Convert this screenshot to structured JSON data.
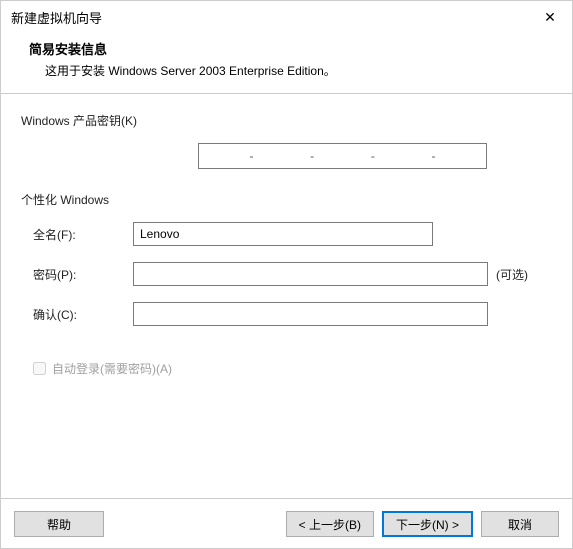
{
  "window": {
    "title": "新建虚拟机向导"
  },
  "header": {
    "subtitle": "简易安装信息",
    "description": "这用于安装 Windows Server 2003 Enterprise Edition。"
  },
  "productkey": {
    "label": "Windows 产品密钥(K)",
    "separator": "-"
  },
  "personalize": {
    "label": "个性化 Windows",
    "fullname_label": "全名(F):",
    "fullname_value": "Lenovo",
    "password_label": "密码(P):",
    "password_value": "",
    "password_hint": "(可选)",
    "confirm_label": "确认(C):",
    "confirm_value": ""
  },
  "autologin": {
    "label": "自动登录(需要密码)(A)",
    "checked": false,
    "enabled": false
  },
  "buttons": {
    "help": "帮助",
    "back": "< 上一步(B)",
    "next": "下一步(N) >",
    "cancel": "取消"
  },
  "watermark": ""
}
